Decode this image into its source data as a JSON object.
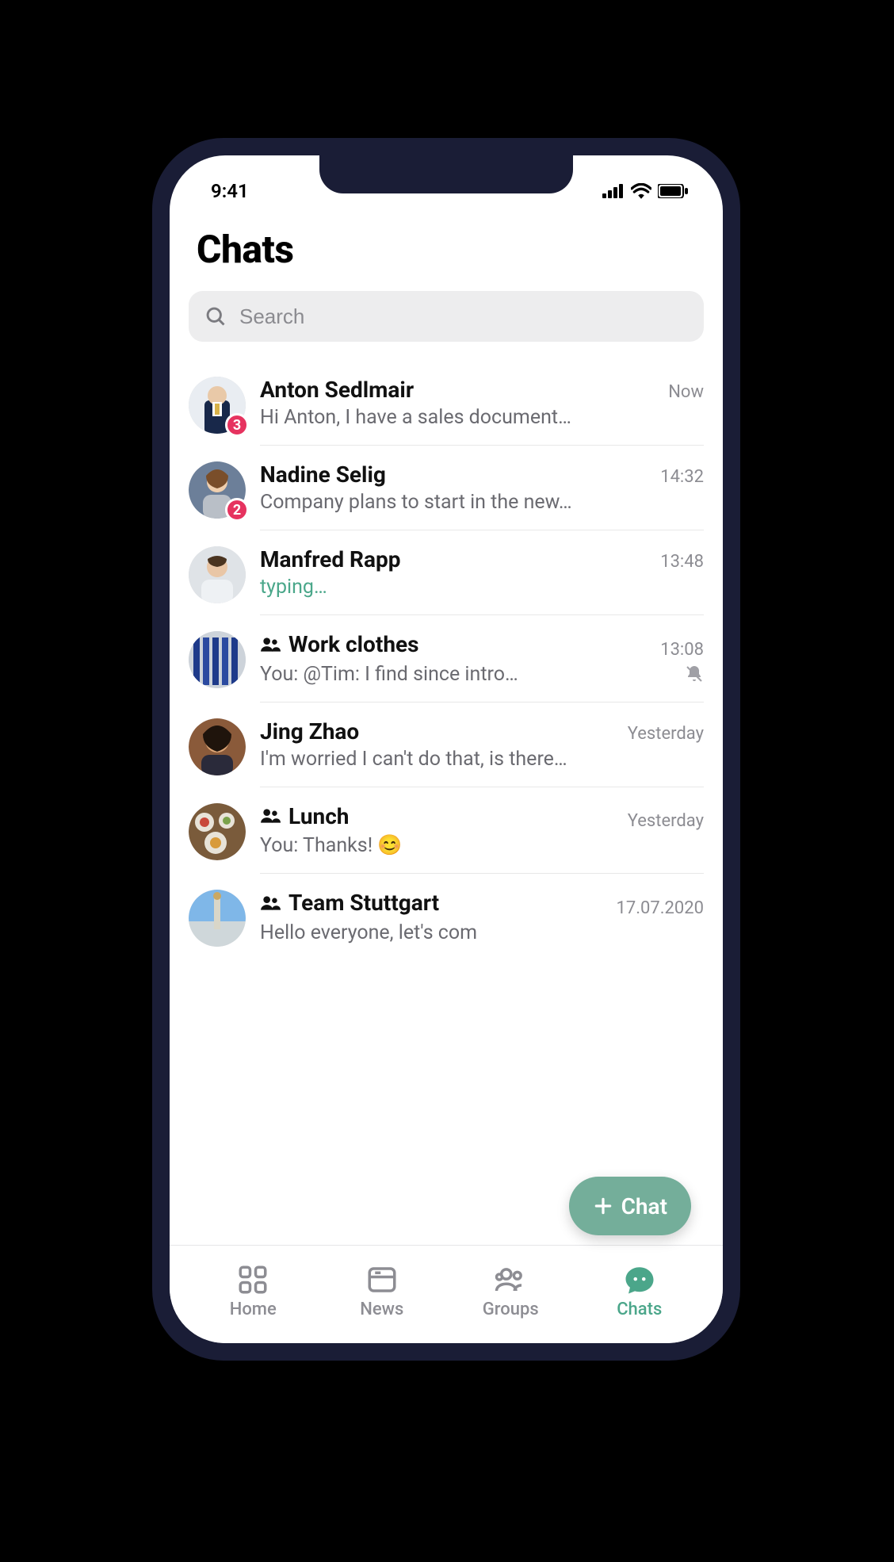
{
  "status": {
    "time": "9:41"
  },
  "page": {
    "title": "Chats"
  },
  "search": {
    "placeholder": "Search"
  },
  "fab": {
    "label": "Chat"
  },
  "colors": {
    "accent": "#4ba68a",
    "fab_bg": "#74ae9a",
    "unread_badge": "#e6335f"
  },
  "chats": [
    {
      "name": "Anton Sedlmair",
      "time": "Now",
      "preview": "Hi Anton, I have a sales document…",
      "group": false,
      "unread": 3,
      "muted": false,
      "typing": false
    },
    {
      "name": "Nadine Selig",
      "time": "14:32",
      "preview": "Company plans to start in the new…",
      "group": false,
      "unread": 2,
      "muted": false,
      "typing": false
    },
    {
      "name": "Manfred Rapp",
      "time": "13:48",
      "preview": "typing…",
      "group": false,
      "unread": 0,
      "muted": false,
      "typing": true
    },
    {
      "name": "Work clothes",
      "time": "13:08",
      "preview": "You: @Tim: I find since intro…",
      "group": true,
      "unread": 0,
      "muted": true,
      "typing": false
    },
    {
      "name": "Jing Zhao",
      "time": "Yesterday",
      "preview": "I'm worried I can't do that, is there…",
      "group": false,
      "unread": 0,
      "muted": false,
      "typing": false
    },
    {
      "name": "Lunch",
      "time": "Yesterday",
      "preview": "You: Thanks! 😊",
      "group": true,
      "unread": 0,
      "muted": false,
      "typing": false
    },
    {
      "name": "Team Stuttgart",
      "time": "17.07.2020",
      "preview": "Hello everyone, let's com",
      "group": true,
      "unread": 0,
      "muted": false,
      "typing": false
    }
  ],
  "tabs": [
    {
      "label": "Home",
      "active": false
    },
    {
      "label": "News",
      "active": false
    },
    {
      "label": "Groups",
      "active": false
    },
    {
      "label": "Chats",
      "active": true
    }
  ]
}
